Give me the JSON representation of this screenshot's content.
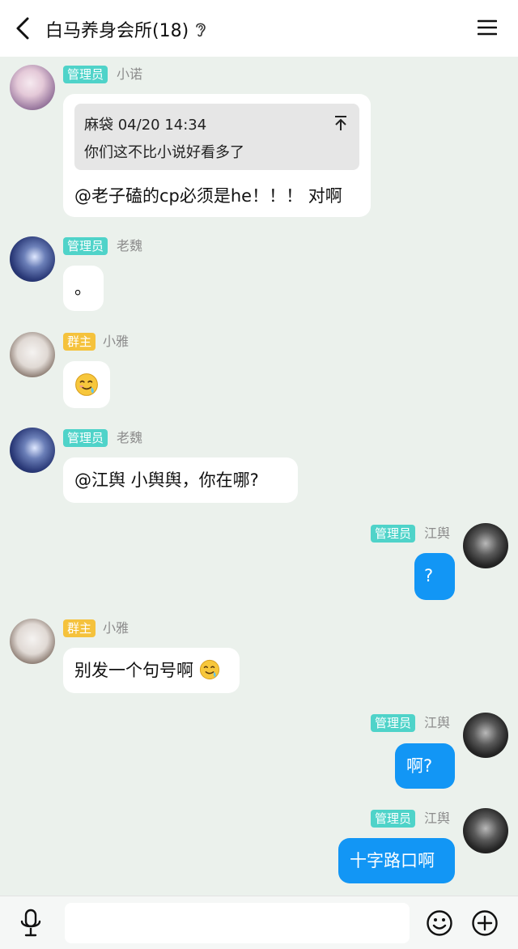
{
  "header": {
    "title": "白马养身会所(18)",
    "back_icon": "chevron-left-icon",
    "ear_icon": "ear-icon",
    "menu_icon": "hamburger-menu-icon"
  },
  "messages": [
    {
      "sender": "小诺",
      "role": "管理员",
      "quote": {
        "author_time": "麻袋 04/20 14:34",
        "text": "你们这不比小说好看多了"
      },
      "text": "@老子磕的cp必须是he！！！ 对啊"
    },
    {
      "sender": "老魏",
      "role": "管理员",
      "text": "。"
    },
    {
      "sender": "小雅",
      "role": "群主",
      "emoji": "sweat-smile-emoji"
    },
    {
      "sender": "老魏",
      "role": "管理员",
      "text": "@江舆 小舆舆，你在哪?"
    },
    {
      "sender": "江舆",
      "role": "管理员",
      "text": "?"
    },
    {
      "sender": "小雅",
      "role": "群主",
      "text": "别发一个句号啊"
    },
    {
      "sender": "江舆",
      "role": "管理员",
      "text": "啊?"
    },
    {
      "sender": "江舆",
      "role": "管理员",
      "text": "十字路口啊"
    }
  ],
  "footer": {
    "mic_icon": "microphone-icon",
    "input_value": "",
    "emoji_icon": "smiley-icon",
    "plus_icon": "plus-circle-icon"
  },
  "colors": {
    "background": "#ebf1ec",
    "admin_badge": "#4fd3c9",
    "owner_badge": "#f5c23c",
    "my_bubble": "#1296f5"
  }
}
